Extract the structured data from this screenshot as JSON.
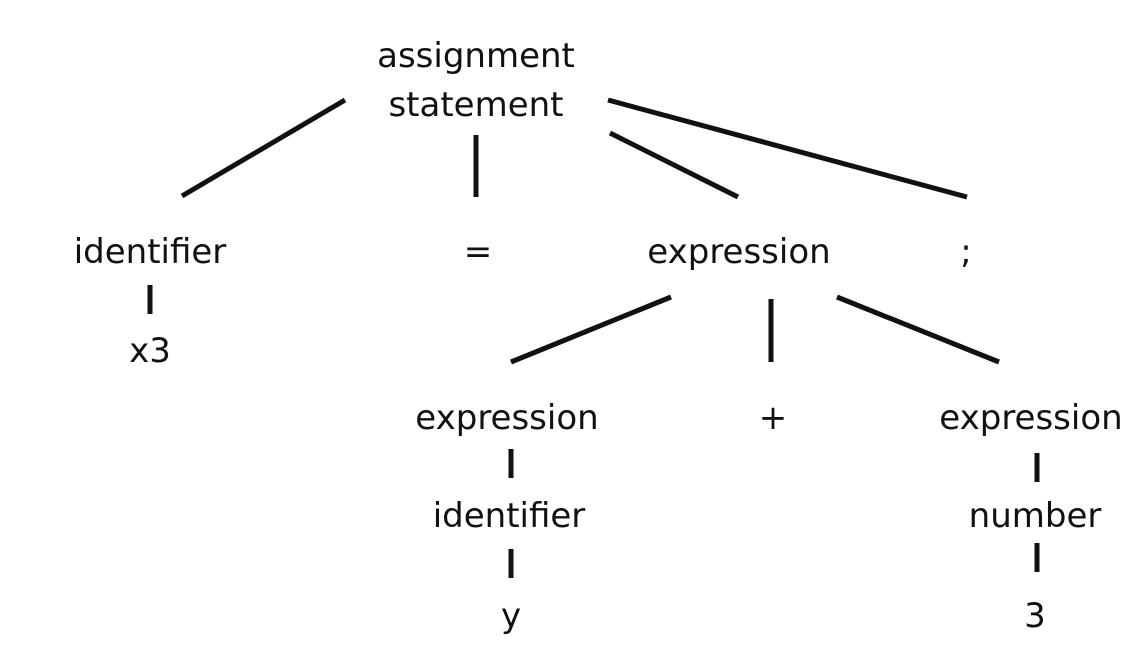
{
  "tree": {
    "root": {
      "line1": "assignment",
      "line2": "statement"
    },
    "identifier_left": "identifier",
    "x3": "x3",
    "equals": "=",
    "expression_main": "expression",
    "semicolon": ";",
    "expression_left": "expression",
    "plus": "+",
    "expression_right": "expression",
    "identifier_y": "identifier",
    "y": "y",
    "number": "number",
    "three": "3"
  }
}
